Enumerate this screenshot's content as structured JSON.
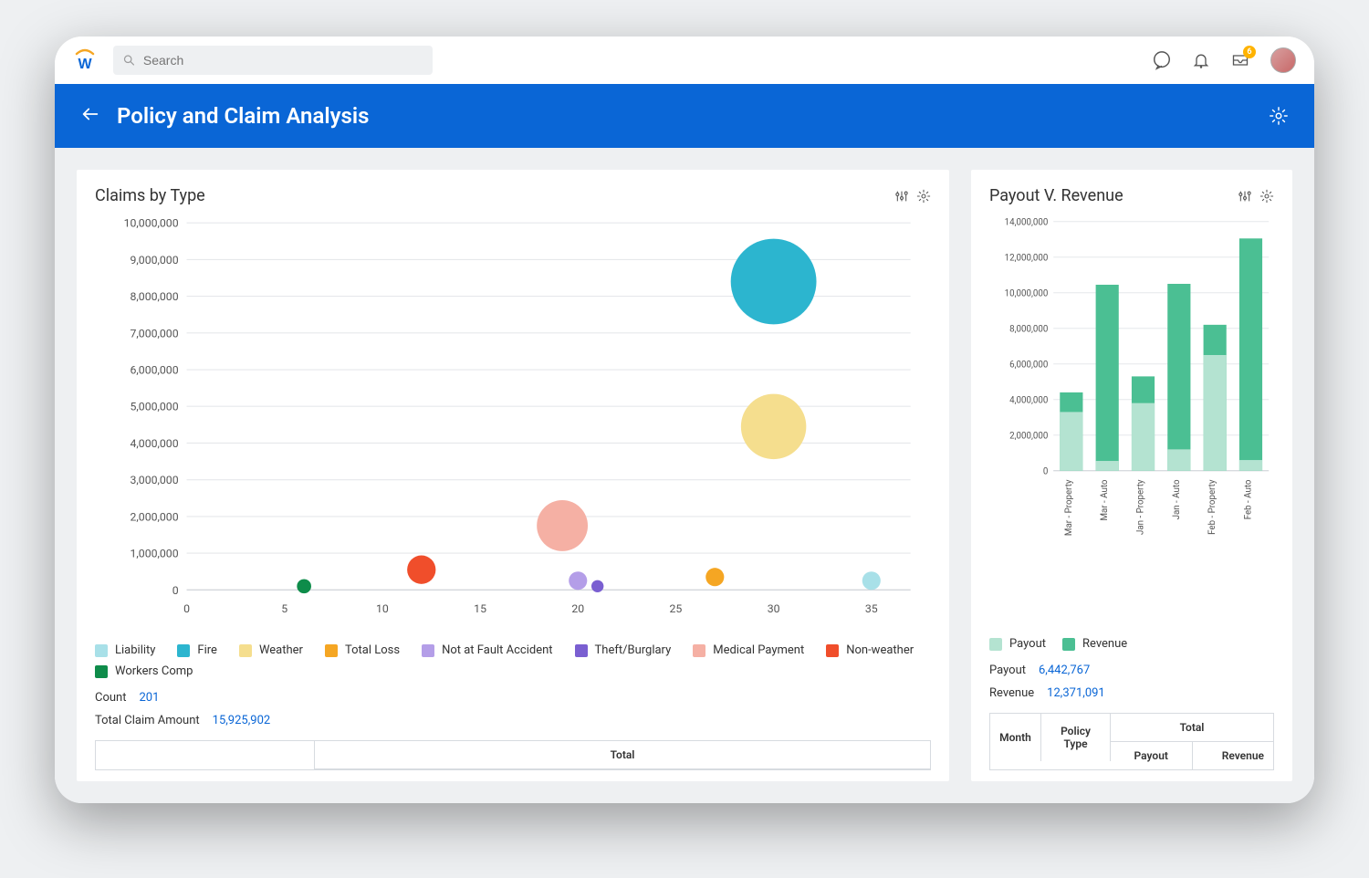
{
  "search": {
    "placeholder": "Search"
  },
  "topbar": {
    "inbox_badge": "6"
  },
  "header": {
    "title": "Policy and Claim Analysis"
  },
  "claims_card": {
    "title": "Claims by Type",
    "count_label": "Count",
    "count_value": "201",
    "total_label": "Total Claim Amount",
    "total_value": "15,925,902",
    "table_header_total": "Total",
    "legend": [
      {
        "label": "Liability",
        "color": "#a8e0e8"
      },
      {
        "label": "Fire",
        "color": "#2cb5cf"
      },
      {
        "label": "Weather",
        "color": "#f5de8e"
      },
      {
        "label": "Total Loss",
        "color": "#f5a623"
      },
      {
        "label": "Not at Fault Accident",
        "color": "#b49ee8"
      },
      {
        "label": "Theft/Burglary",
        "color": "#7a5fd1"
      },
      {
        "label": "Medical Payment",
        "color": "#f5b0a4"
      },
      {
        "label": "Non-weather",
        "color": "#f04e2b"
      },
      {
        "label": "Workers Comp",
        "color": "#0e8c4a"
      }
    ]
  },
  "payout_card": {
    "title": "Payout V. Revenue",
    "legend": [
      {
        "label": "Payout",
        "color": "#b4e3d1"
      },
      {
        "label": "Revenue",
        "color": "#4bbf93"
      }
    ],
    "payout_label": "Payout",
    "payout_value": "6,442,767",
    "revenue_label": "Revenue",
    "revenue_value": "12,371,091",
    "table": {
      "col_month": "Month",
      "col_policy": "Policy Type",
      "col_total": "Total",
      "col_payout": "Payout",
      "col_revenue": "Revenue"
    }
  },
  "chart_data": [
    {
      "type": "scatter",
      "title": "Claims by Type",
      "xlabel": "",
      "ylabel": "",
      "xlim": [
        0,
        37
      ],
      "ylim": [
        0,
        10000000
      ],
      "xticks": [
        0,
        5,
        10,
        15,
        20,
        25,
        30,
        35
      ],
      "yticks": [
        0,
        1000000,
        2000000,
        3000000,
        4000000,
        5000000,
        6000000,
        7000000,
        8000000,
        9000000,
        10000000
      ],
      "series": [
        {
          "name": "Workers Comp",
          "color": "#0e8c4a",
          "x": 6,
          "y": 100000,
          "r": 7
        },
        {
          "name": "Non-weather",
          "color": "#f04e2b",
          "x": 12,
          "y": 550000,
          "r": 14
        },
        {
          "name": "Medical Payment",
          "color": "#f5b0a4",
          "x": 19.2,
          "y": 1750000,
          "r": 25
        },
        {
          "name": "Not at Fault Accident",
          "color": "#b49ee8",
          "x": 20,
          "y": 250000,
          "r": 9
        },
        {
          "name": "Theft/Burglary",
          "color": "#7a5fd1",
          "x": 21,
          "y": 100000,
          "r": 6
        },
        {
          "name": "Total Loss",
          "color": "#f5a623",
          "x": 27,
          "y": 350000,
          "r": 9
        },
        {
          "name": "Weather",
          "color": "#f5de8e",
          "x": 30,
          "y": 4450000,
          "r": 32
        },
        {
          "name": "Fire",
          "color": "#2cb5cf",
          "x": 30,
          "y": 8400000,
          "r": 42
        },
        {
          "name": "Liability",
          "color": "#a8e0e8",
          "x": 35,
          "y": 250000,
          "r": 9
        }
      ]
    },
    {
      "type": "bar",
      "title": "Payout V. Revenue",
      "categories": [
        "Mar - Property",
        "Mar - Auto",
        "Jan - Property",
        "Jan - Auto",
        "Feb - Property",
        "Feb - Auto"
      ],
      "ylim": [
        0,
        14000000
      ],
      "yticks": [
        0,
        2000000,
        4000000,
        6000000,
        8000000,
        10000000,
        12000000,
        14000000
      ],
      "series": [
        {
          "name": "Payout",
          "color": "#b4e3d1",
          "values": [
            3300000,
            550000,
            3800000,
            1200000,
            6500000,
            600000
          ]
        },
        {
          "name": "Revenue",
          "color": "#4bbf93",
          "values": [
            4400000,
            10450000,
            5300000,
            10500000,
            8200000,
            13050000
          ]
        }
      ]
    }
  ]
}
